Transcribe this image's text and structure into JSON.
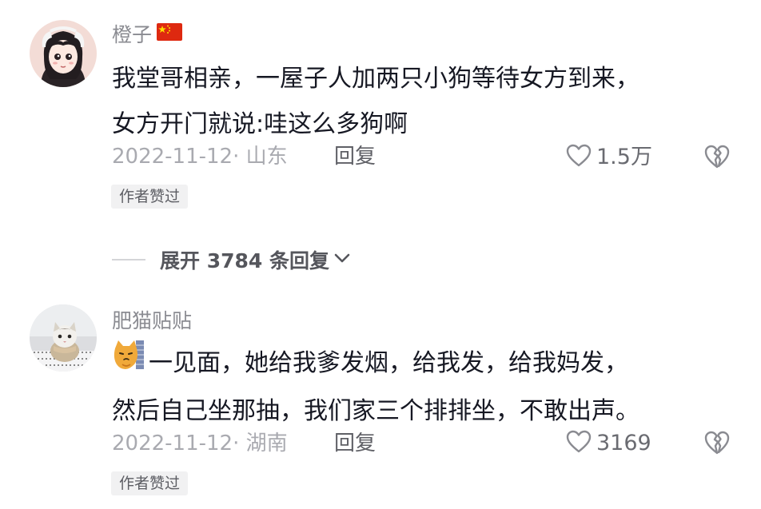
{
  "comments": [
    {
      "username": "橙子",
      "lines": [
        "我堂哥相亲，一屋子人加两只小狗等待女方到来，",
        "女方开门就说:哇这么多狗啊"
      ],
      "date_location": "2022-11-12· 山东",
      "reply_label": "回复",
      "likes": "1.5万",
      "badge": "作者赞过",
      "flag_icon": "china-flag-icon"
    },
    {
      "username": "肥猫贴贴",
      "lines": [
        "一见面，她给我爹发烟，给我发，给我妈发，",
        "然后自己坐那抽，我们家三个排排坐，不敢出声。"
      ],
      "date_location": "2022-11-12· 湖南",
      "reply_label": "回复",
      "likes": "3169",
      "badge": "作者赞过",
      "emoji_icon": "cat-emoji-icon"
    }
  ],
  "expand_replies": {
    "label": "展开 3784 条回复"
  },
  "colors": {
    "username": "#8a8b91",
    "text": "#161823",
    "meta": "#a9aab0",
    "badge_bg": "#f1f1f2"
  }
}
